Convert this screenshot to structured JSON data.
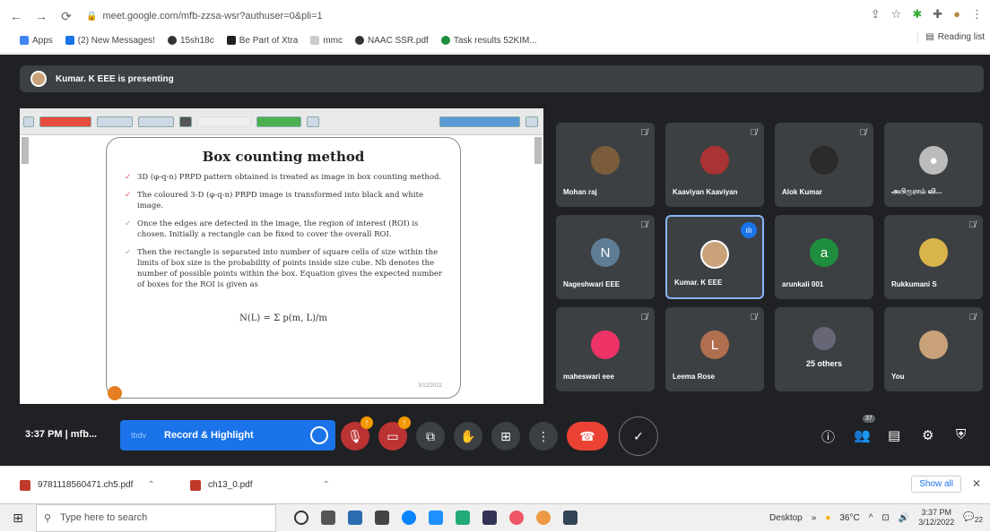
{
  "browser": {
    "url": "meet.google.com/mfb-zzsa-wsr?authuser=0&pli=1",
    "bookmarks": [
      "Apps",
      "(2) New Messages!",
      "15sh18c",
      "Be Part of Xtra",
      "mmc",
      "NAAC SSR.pdf",
      "Task results 52KIM..."
    ],
    "reading_list": "Reading list"
  },
  "meet": {
    "presenting_text": "Kumar. K EEE is presenting",
    "slide": {
      "title": "Box counting method",
      "bullets": [
        "3D (φ-q-n) PRPD pattern obtained is treated as image in box counting method.",
        "The coloured 3-D (φ-q-n) PRPD image is transformed into black and white image.",
        "Once the edges are detected in the image, the region of interest (ROI) is chosen. Initially a rectangle can be fixed to cover the overall ROI.",
        "Then the rectangle is separated into number of square cells of size within the limits of box size is the probability of points inside size cube. Nb denotes the number of possible points within the box. Equation gives the expected number of boxes for the ROI is given as"
      ],
      "equation": "N(L) = Σ p(m, L)/m",
      "date": "3/12/2022"
    },
    "participants": [
      {
        "name": "Mohan raj",
        "initial": "",
        "color": "#7a5c3a"
      },
      {
        "name": "Kaaviyan Kaaviyan",
        "initial": "",
        "color": "#a33"
      },
      {
        "name": "Alok Kumar",
        "initial": "",
        "color": "#2b2b2b"
      },
      {
        "name": "அபிரூராம் வி...",
        "initial": "",
        "color": "#bbb"
      },
      {
        "name": "Nageshwari EEE",
        "initial": "N",
        "color": "#5f7d95"
      },
      {
        "name": "Kumar. K EEE",
        "initial": "",
        "color": "#c9a27a"
      },
      {
        "name": "arunkali 001",
        "initial": "a",
        "color": "#1e8e3e"
      },
      {
        "name": "Rukkumani S",
        "initial": "",
        "color": "#d9b44a"
      },
      {
        "name": "maheswari eee",
        "initial": "",
        "color": "#e36"
      },
      {
        "name": "Leema Rose",
        "initial": "L",
        "color": "#b07050"
      },
      {
        "name": "25 others",
        "initial": "",
        "color": "#667"
      },
      {
        "name": "You",
        "initial": "",
        "color": "#c9a27a"
      }
    ],
    "controls": {
      "time": "3:37 PM",
      "meeting_code": "mfb...",
      "record_tab": "tbdv",
      "record_label": "Record & Highlight",
      "participant_count": "37"
    }
  },
  "downloads": {
    "items": [
      "9781118560471.ch5.pdf",
      "ch13_0.pdf"
    ],
    "show_all": "Show all"
  },
  "taskbar": {
    "search_placeholder": "Type here to search",
    "desktop": "Desktop",
    "weather": "36°C",
    "time": "3:37 PM",
    "date": "3/12/2022",
    "notifications": "22"
  }
}
